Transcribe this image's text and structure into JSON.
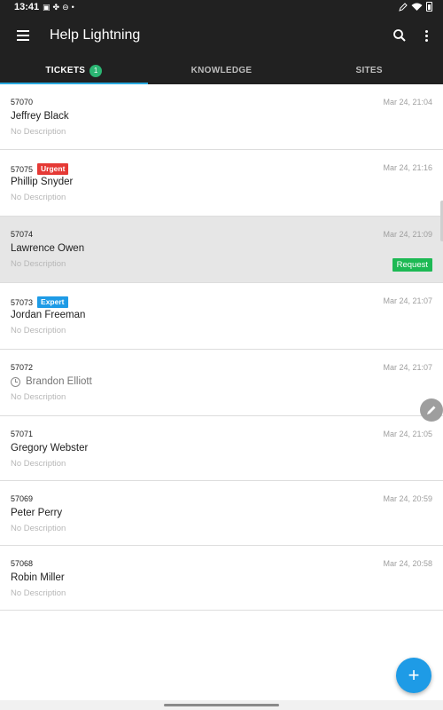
{
  "status_bar": {
    "time": "13:41",
    "icons": [
      "image-icon",
      "pinwheel-icon",
      "do-not-disturb-icon",
      "dot-icon"
    ],
    "right_icons": [
      "pen-icon",
      "wifi-icon",
      "battery-icon"
    ]
  },
  "app_bar": {
    "title": "Help Lightning",
    "icons": [
      "menu-icon",
      "search-icon",
      "more-vert-icon"
    ]
  },
  "tabs": [
    {
      "label": "TICKETS",
      "badge": "1",
      "active": true
    },
    {
      "label": "KNOWLEDGE",
      "active": false
    },
    {
      "label": "SITES",
      "active": false
    }
  ],
  "tickets": [
    {
      "id": "57070",
      "name": "Jeffrey Black",
      "date": "Mar 24, 21:04",
      "description": "No Description"
    },
    {
      "id": "57075",
      "tag": "Urgent",
      "name": "Phillip Snyder",
      "date": "Mar 24, 21:16",
      "description": "No Description"
    },
    {
      "id": "57074",
      "name": "Lawrence Owen",
      "date": "Mar 24, 21:09",
      "description": "No Description",
      "action": "Request"
    },
    {
      "id": "57073",
      "tag": "Expert",
      "name": "Jordan Freeman",
      "date": "Mar 24, 21:07",
      "description": "No Description"
    },
    {
      "id": "57072",
      "name": "Brandon Elliott",
      "date": "Mar 24, 21:07",
      "description": "No Description",
      "pending": true
    },
    {
      "id": "57071",
      "name": "Gregory Webster",
      "date": "Mar 24, 21:05",
      "description": "No Description"
    },
    {
      "id": "57069",
      "name": "Peter Perry",
      "date": "Mar 24, 20:59",
      "description": "No Description"
    },
    {
      "id": "57068",
      "name": "Robin Miller",
      "date": "Mar 24, 20:58",
      "description": "No Description"
    }
  ],
  "colors": {
    "app_bar_bg": "#212121",
    "tab_indicator": "#29a9e0",
    "badge_green": "#2bb673",
    "urgent_red": "#e53935",
    "expert_blue": "#1e9be6",
    "request_green": "#1db954",
    "fab_blue": "#1e9be6"
  },
  "fab": {
    "icon": "add-icon",
    "symbol": "+"
  },
  "edit_button": {
    "icon": "pencil-icon"
  }
}
